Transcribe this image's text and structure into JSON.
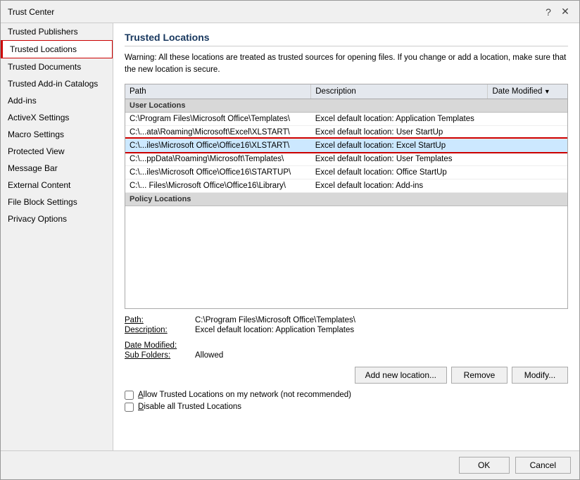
{
  "dialog": {
    "title": "Trust Center",
    "help_icon": "?",
    "close_icon": "✕"
  },
  "sidebar": {
    "items": [
      {
        "id": "trusted-publishers",
        "label": "Trusted Publishers",
        "active": false
      },
      {
        "id": "trusted-locations",
        "label": "Trusted Locations",
        "active": true
      },
      {
        "id": "trusted-documents",
        "label": "Trusted Documents",
        "active": false
      },
      {
        "id": "trusted-addin-catalogs",
        "label": "Trusted Add-in Catalogs",
        "active": false
      },
      {
        "id": "add-ins",
        "label": "Add-ins",
        "active": false
      },
      {
        "id": "activex-settings",
        "label": "ActiveX Settings",
        "active": false
      },
      {
        "id": "macro-settings",
        "label": "Macro Settings",
        "active": false
      },
      {
        "id": "protected-view",
        "label": "Protected View",
        "active": false
      },
      {
        "id": "message-bar",
        "label": "Message Bar",
        "active": false
      },
      {
        "id": "external-content",
        "label": "External Content",
        "active": false
      },
      {
        "id": "file-block-settings",
        "label": "File Block Settings",
        "active": false
      },
      {
        "id": "privacy-options",
        "label": "Privacy Options",
        "active": false
      }
    ]
  },
  "content": {
    "title": "Trusted Locations",
    "warning": "Warning: All these locations are treated as trusted sources for opening files.  If you change or add a location, make sure that the new location is secure.",
    "table": {
      "columns": [
        {
          "id": "path",
          "label": "Path"
        },
        {
          "id": "description",
          "label": "Description"
        },
        {
          "id": "date_modified",
          "label": "Date Modified",
          "sortable": true
        }
      ],
      "sections": [
        {
          "id": "user-locations",
          "label": "User Locations",
          "rows": [
            {
              "id": 1,
              "path": "C:\\Program Files\\Microsoft Office\\Templates\\",
              "description": "Excel default location: Application Templates",
              "date": "",
              "selected": false
            },
            {
              "id": 2,
              "path": "C:\\...ata\\Roaming\\Microsoft\\Excel\\XLSTART\\",
              "description": "Excel default location: User StartUp",
              "date": "",
              "selected": false
            },
            {
              "id": 3,
              "path": "C:\\...iles\\Microsoft Office\\Office16\\XLSTART\\",
              "description": "Excel default location: Excel StartUp",
              "date": "",
              "selected": true
            },
            {
              "id": 4,
              "path": "C:\\...ppData\\Roaming\\Microsoft\\Templates\\",
              "description": "Excel default location: User Templates",
              "date": "",
              "selected": false
            },
            {
              "id": 5,
              "path": "C:\\...iles\\Microsoft Office\\Office16\\STARTUP\\",
              "description": "Excel default location: Office StartUp",
              "date": "",
              "selected": false
            },
            {
              "id": 6,
              "path": "C:\\... Files\\Microsoft Office\\Office16\\Library\\",
              "description": "Excel default location: Add-ins",
              "date": "",
              "selected": false
            }
          ]
        },
        {
          "id": "policy-locations",
          "label": "Policy Locations",
          "rows": []
        }
      ]
    },
    "details": {
      "path_label": "Path:",
      "path_value": "C:\\Program Files\\Microsoft Office\\Templates\\",
      "description_label": "Description:",
      "description_value": "Excel default location: Application Templates",
      "date_modified_label": "Date Modified:",
      "date_modified_value": "",
      "sub_folders_label": "Sub Folders:",
      "sub_folders_value": "Allowed"
    },
    "buttons": {
      "add_new": "Add new location...",
      "remove": "Remove",
      "modify": "Modify..."
    },
    "checkboxes": [
      {
        "id": "allow-network",
        "label": "Allow Trusted Locations on my network (not recommended)",
        "underline_char": "A",
        "checked": false
      },
      {
        "id": "disable-all",
        "label": "Disable all Trusted Locations",
        "underline_char": "D",
        "checked": false
      }
    ]
  },
  "footer": {
    "ok_label": "OK",
    "cancel_label": "Cancel"
  }
}
